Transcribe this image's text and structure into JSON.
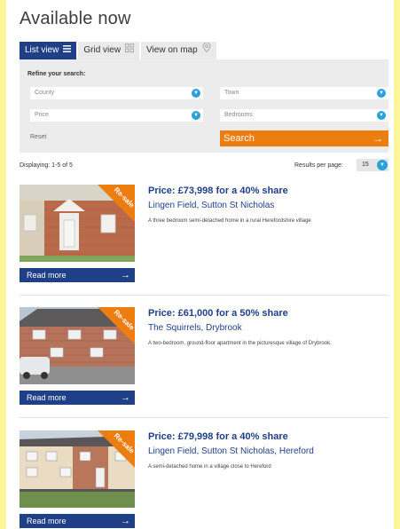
{
  "page": {
    "title": "Available now"
  },
  "tabs": [
    {
      "label": "List view",
      "icon": "list-icon",
      "active": true
    },
    {
      "label": "Grid view",
      "icon": "grid-icon",
      "active": false
    },
    {
      "label": "View on map",
      "icon": "map-pin-icon",
      "active": false
    }
  ],
  "refine": {
    "title": "Refine your search:",
    "county_placeholder": "County",
    "town_placeholder": "Town",
    "price_placeholder": "Price",
    "bedrooms_placeholder": "Bedrooms",
    "reset_label": "Reset",
    "search_label": "Search"
  },
  "results": {
    "displaying": "Displaying: 1-5 of 5",
    "per_page_label": "Results per page:",
    "per_page_value": "15"
  },
  "listings": [
    {
      "badge": "Re-sale",
      "price": "Price: £73,998 for a 40% share",
      "address": "Lingen Field, Sutton St Nicholas",
      "description": "A three bedroom semi-detached home in a rural Herefordshire village",
      "read_more": "Read more"
    },
    {
      "badge": "Re-sale",
      "price": "Price: £61,000 for a 50% share",
      "address": "The Squirrels, Drybrook",
      "description": "A two-bedroom, ground-floor apartment in the picturesque village of Drybrook.",
      "read_more": "Read more"
    },
    {
      "badge": "Re-sale",
      "price": "Price: £79,998 for a 40% share",
      "address": "Lingen Field, Sutton St Nicholas, Hereford",
      "description": "A semi-detached home in a village close to Hereford",
      "read_more": "Read more"
    }
  ],
  "colors": {
    "navy": "#1f3f86",
    "orange": "#ee7d10",
    "dropdown_blue": "#2aa0dc",
    "page_background": "#fdf59a"
  }
}
